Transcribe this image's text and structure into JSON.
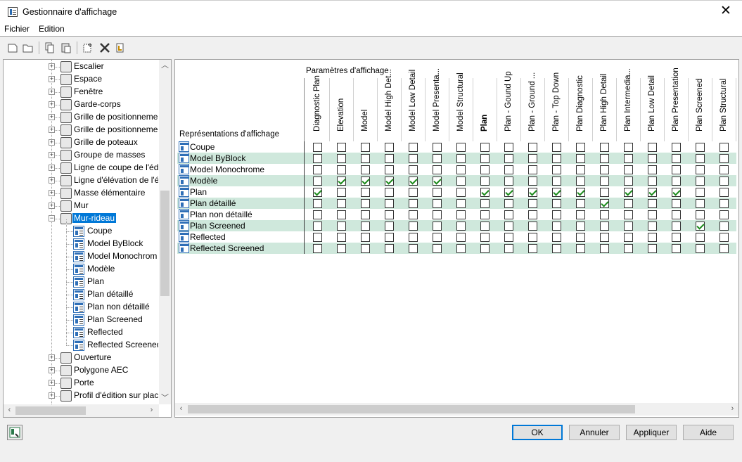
{
  "window": {
    "title": "Gestionnaire d'affichage",
    "close_glyph": "✕"
  },
  "menu": {
    "items": [
      "Fichier",
      "Edition"
    ]
  },
  "toolbar": {
    "icons": [
      "new-icon",
      "open-icon",
      "copy-icon",
      "paste-icon",
      "purge-icon",
      "delete-icon",
      "edit-icon"
    ]
  },
  "tree": {
    "objects_top": [
      "Escalier",
      "Espace",
      "Fenêtre",
      "Garde-corps",
      "Grille de positionneme",
      "Grille de positionneme",
      "Grille de poteaux",
      "Groupe de masses",
      "Ligne de coupe de l'éd",
      "Ligne d'élévation de l'é",
      "Masse élémentaire",
      "Mur"
    ],
    "selected": "Mur-rideau",
    "children": [
      "Coupe",
      "Model ByBlock",
      "Model Monochrom",
      "Modèle",
      "Plan",
      "Plan détaillé",
      "Plan non détaillé",
      "Plan Screened",
      "Reflected",
      "Reflected Screened"
    ],
    "objects_bottom": [
      "Ouverture",
      "Polygone AEC",
      "Porte",
      "Profil d'édition sur plac"
    ]
  },
  "grid": {
    "group_header": "Paramètres d'affichage",
    "row_header": "Représentations d'affichage",
    "columns": [
      "Diagnostic Plan",
      "Elevation",
      "Model",
      "Model High Det...",
      "Model Low Detail",
      "Model Presenta...",
      "Model Structural",
      "Plan",
      "Plan - Gound Up",
      "Plan - Ground ...",
      "Plan - Top Down",
      "Plan Diagnostic",
      "Plan High Detail",
      "Plan Intermedia...",
      "Plan Low Detail",
      "Plan Presentation",
      "Plan Screened",
      "Plan Structural"
    ],
    "bold_column": "Plan",
    "rows": [
      {
        "label": "Coupe",
        "checks": [
          0,
          0,
          0,
          0,
          0,
          0,
          0,
          0,
          0,
          0,
          0,
          0,
          0,
          0,
          0,
          0,
          0,
          0
        ]
      },
      {
        "label": "Model ByBlock",
        "checks": [
          0,
          0,
          0,
          0,
          0,
          0,
          0,
          0,
          0,
          0,
          0,
          0,
          0,
          0,
          0,
          0,
          0,
          0
        ]
      },
      {
        "label": "Model Monochrome",
        "checks": [
          0,
          0,
          0,
          0,
          0,
          0,
          0,
          0,
          0,
          0,
          0,
          0,
          0,
          0,
          0,
          0,
          0,
          0
        ]
      },
      {
        "label": "Modèle",
        "checks": [
          0,
          1,
          1,
          1,
          1,
          1,
          0,
          0,
          0,
          0,
          0,
          0,
          0,
          0,
          0,
          0,
          0,
          0
        ]
      },
      {
        "label": "Plan",
        "checks": [
          1,
          0,
          0,
          0,
          0,
          0,
          0,
          1,
          1,
          1,
          1,
          1,
          0,
          1,
          1,
          1,
          0,
          0
        ]
      },
      {
        "label": "Plan détaillé",
        "checks": [
          0,
          0,
          0,
          0,
          0,
          0,
          0,
          0,
          0,
          0,
          0,
          0,
          1,
          0,
          0,
          0,
          0,
          0
        ]
      },
      {
        "label": "Plan non détaillé",
        "checks": [
          0,
          0,
          0,
          0,
          0,
          0,
          0,
          0,
          0,
          0,
          0,
          0,
          0,
          0,
          0,
          0,
          0,
          0
        ]
      },
      {
        "label": "Plan Screened",
        "checks": [
          0,
          0,
          0,
          0,
          0,
          0,
          0,
          0,
          0,
          0,
          0,
          0,
          0,
          0,
          0,
          0,
          1,
          0
        ]
      },
      {
        "label": "Reflected",
        "checks": [
          0,
          0,
          0,
          0,
          0,
          0,
          0,
          0,
          0,
          0,
          0,
          0,
          0,
          0,
          0,
          0,
          0,
          0
        ]
      },
      {
        "label": "Reflected Screened",
        "checks": [
          0,
          0,
          0,
          0,
          0,
          0,
          0,
          0,
          0,
          0,
          0,
          0,
          0,
          0,
          0,
          0,
          0,
          0
        ]
      }
    ]
  },
  "buttons": {
    "ok": "OK",
    "cancel": "Annuler",
    "apply": "Appliquer",
    "help": "Aide"
  },
  "colors": {
    "selection": "#0078d7",
    "row_alt": "#cfe8dc",
    "check": "#1a8a1a"
  }
}
